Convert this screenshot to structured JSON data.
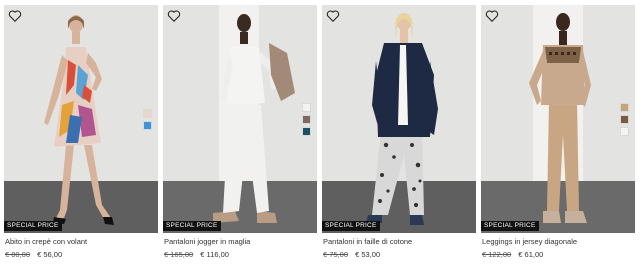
{
  "products": [
    {
      "name": "Abito in crepè con volant",
      "badge": "SPECIAL PRICE",
      "old_price": "€ 80,00",
      "new_price": "€ 56,00",
      "swatches": [
        "#e9d7cd",
        "#3c95d8"
      ]
    },
    {
      "name": "Pantaloni jogger in maglia",
      "badge": "SPECIAL PRICE",
      "old_price": "€ 165,00",
      "new_price": "€ 116,00",
      "swatches": [
        "#f4f4f2",
        "#7f6a5d",
        "#1f4f66"
      ]
    },
    {
      "name": "Pantaloni in faille di cotone",
      "badge": "SPECIAL PRICE",
      "old_price": "€ 75,00",
      "new_price": "€ 53,00",
      "swatches": []
    },
    {
      "name": "Leggings in jersey diagonale",
      "badge": "SPECIAL PRICE",
      "old_price": "€ 122,00",
      "new_price": "€ 61,00",
      "swatches": [
        "#c6a27d",
        "#7a5a3f",
        "#f5f4f1"
      ]
    }
  ],
  "icons": {
    "favorite": "heart-outline-icon"
  }
}
